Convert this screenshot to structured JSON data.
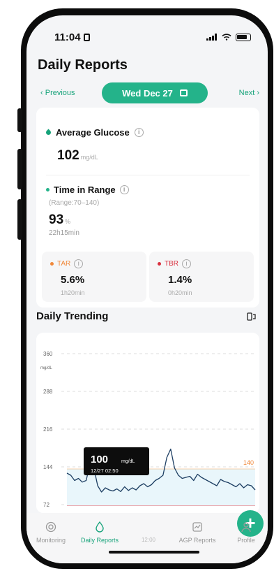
{
  "status": {
    "time": "11:04"
  },
  "page": {
    "title": "Daily Reports"
  },
  "datebar": {
    "previous": "Previous",
    "date": "Wed Dec 27",
    "next": "Next"
  },
  "average": {
    "label": "Average Glucose",
    "value": "102",
    "unit": "mg/dL"
  },
  "tir": {
    "label": "Time in Range",
    "range": "(Range:70–140)",
    "value": "93",
    "unit": "%",
    "duration": "22h15min"
  },
  "tar": {
    "label": "TAR",
    "value": "5.6%",
    "duration": "1h20min",
    "color": "#f0883a"
  },
  "tbr": {
    "label": "TBR",
    "value": "1.4%",
    "duration": "0h20min",
    "color": "#d9303f"
  },
  "trend": {
    "title": "Daily Trending"
  },
  "chart_data": {
    "type": "line",
    "ylabel": "mg/dL",
    "yticks": [
      "360",
      "288",
      "216",
      "144",
      "72"
    ],
    "high_threshold": "140",
    "low_threshold": "70",
    "ylim": [
      40,
      400
    ],
    "tooltip": {
      "value": "100",
      "unit": "mg/dL",
      "time": "12/27 02:50"
    },
    "series": [
      {
        "values": [
          132,
          128,
          118,
          122,
          115,
          118,
          150,
          142,
          108,
          96,
          104,
          100,
          98,
          102,
          97,
          106,
          99,
          104,
          100,
          108,
          112,
          106,
          110,
          118,
          122,
          128,
          162,
          178,
          142,
          128,
          122,
          124,
          126,
          118,
          130,
          124,
          120,
          116,
          112,
          108,
          120,
          116,
          114,
          110,
          106,
          112,
          104,
          110,
          108,
          100
        ]
      }
    ]
  },
  "tabs": [
    {
      "label": "Monitoring"
    },
    {
      "label": "Daily Reports"
    },
    {
      "label": "12:00"
    },
    {
      "label": "AGP Reports"
    },
    {
      "label": "Profile"
    }
  ],
  "colors": {
    "accent": "#24b38a",
    "tar": "#f0883a",
    "tbr": "#d9303f"
  }
}
